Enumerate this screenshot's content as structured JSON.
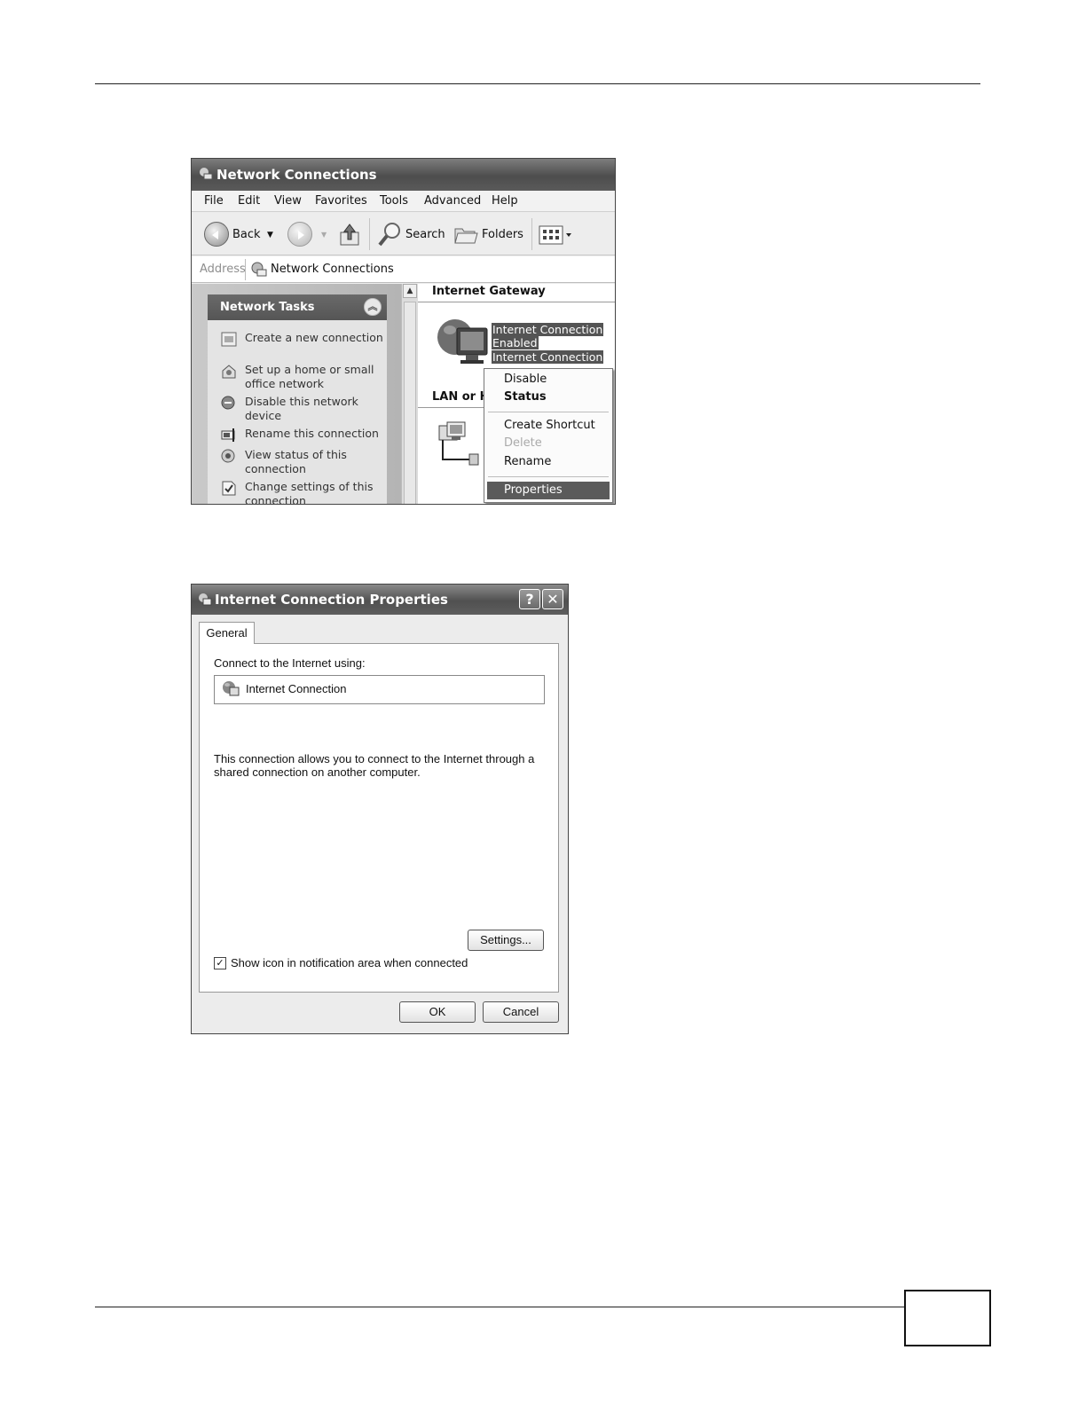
{
  "network_window": {
    "title": "Network Connections",
    "menu": [
      "File",
      "Edit",
      "View",
      "Favorites",
      "Tools",
      "Advanced",
      "Help"
    ],
    "toolbar": {
      "back": "Back",
      "search": "Search",
      "folders": "Folders"
    },
    "address": {
      "label": "Address",
      "value": "Network Connections"
    },
    "tasks": {
      "heading": "Network Tasks",
      "items": [
        "Create a new connection",
        "Set up a home or small office network",
        "Disable this network device",
        "Rename this connection",
        "View status of this connection",
        "Change settings of this connection"
      ]
    },
    "groups": {
      "internet_gateway": "Internet Gateway",
      "lan": "LAN or H"
    },
    "selected_item": {
      "line1": "Internet Connection",
      "line2": "Enabled",
      "line3": "Internet Connection"
    },
    "context_menu": {
      "disable": "Disable",
      "status": "Status",
      "create_shortcut": "Create Shortcut",
      "delete": "Delete",
      "rename": "Rename",
      "properties": "Properties"
    }
  },
  "properties_window": {
    "title": "Internet Connection Properties",
    "help_button": "?",
    "close_button": "✕",
    "tab": "General",
    "connect_label": "Connect to the Internet using:",
    "connection_name": "Internet Connection",
    "description": "This connection allows you to connect to the Internet through a shared connection on another computer.",
    "settings_button": "Settings...",
    "checkbox_label": "Show icon in notification area when connected",
    "checkbox_checked": true,
    "ok_button": "OK",
    "cancel_button": "Cancel"
  }
}
